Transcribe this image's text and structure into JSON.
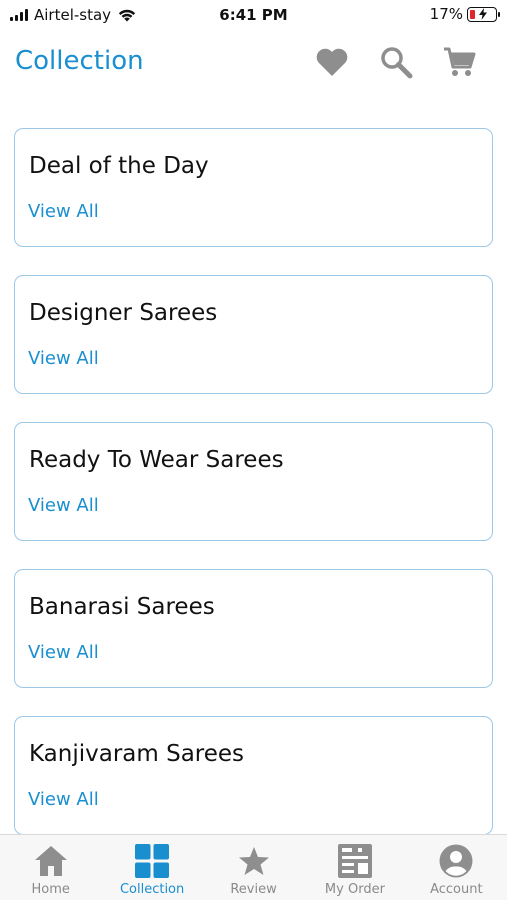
{
  "status_bar": {
    "carrier": "Airtel-stay",
    "time": "6:41 PM",
    "battery": "17%"
  },
  "header": {
    "title": "Collection",
    "icons": [
      "heart-icon",
      "search-icon",
      "cart-icon"
    ]
  },
  "collections": [
    {
      "title": "Deal of the Day",
      "link": "View All"
    },
    {
      "title": "Designer Sarees",
      "link": "View All"
    },
    {
      "title": "Ready To Wear Sarees",
      "link": "View All"
    },
    {
      "title": "Banarasi Sarees",
      "link": "View All"
    },
    {
      "title": "Kanjivaram Sarees",
      "link": "View All"
    }
  ],
  "tabs": [
    {
      "label": "Home",
      "icon": "home-icon"
    },
    {
      "label": "Collection",
      "icon": "grid-icon",
      "active": true
    },
    {
      "label": "Review",
      "icon": "star-icon"
    },
    {
      "label": "My Order",
      "icon": "order-icon"
    },
    {
      "label": "Account",
      "icon": "account-icon"
    }
  ],
  "colors": {
    "accent": "#1a8fd0",
    "card_border": "#9cc8e8",
    "icon_gray": "#8e8e8e",
    "battery_low": "#e0262a"
  }
}
